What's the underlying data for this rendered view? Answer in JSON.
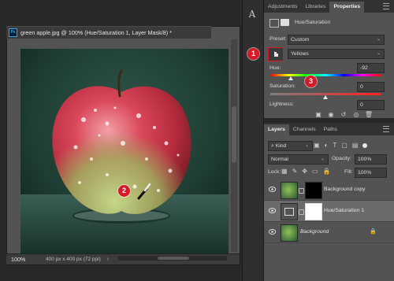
{
  "document": {
    "icon_label": "Ps",
    "tab_title": "green apple.jpg @ 100% (Hue/Saturation 1, Layer Mask/8) *",
    "zoom": "100%",
    "doc_info": "400 px x 400 px (72 ppi)"
  },
  "properties_panel": {
    "tabs": [
      "Adjustments",
      "Libraries",
      "Properties"
    ],
    "active_tab": "Properties",
    "adjustment_title": "Hue/Saturation",
    "preset_label": "Preset:",
    "preset_value": "Custom",
    "channel_value": "Yellows",
    "hue_label": "Hue:",
    "hue_value": "-92",
    "saturation_label": "Saturation:",
    "saturation_value": "0",
    "lightness_label": "Lightness:",
    "lightness_value": "0"
  },
  "layers_panel": {
    "tabs": [
      "Layers",
      "Channels",
      "Paths"
    ],
    "active_tab": "Layers",
    "filter_kind": "Kind",
    "blend_mode": "Normal",
    "opacity_label": "Opacity:",
    "opacity_value": "100%",
    "lock_label": "Lock:",
    "fill_label": "Fill:",
    "fill_value": "100%",
    "layers": [
      {
        "name": "Background copy",
        "italic": false
      },
      {
        "name": "Hue/Saturation 1",
        "italic": false
      },
      {
        "name": "Background",
        "italic": true
      }
    ]
  },
  "annotations": {
    "badge_1": "1",
    "badge_2": "2",
    "badge_3": "3",
    "badge_color": "#d7192a"
  },
  "icons": {
    "character_panel": "A",
    "close_tab": "×"
  }
}
